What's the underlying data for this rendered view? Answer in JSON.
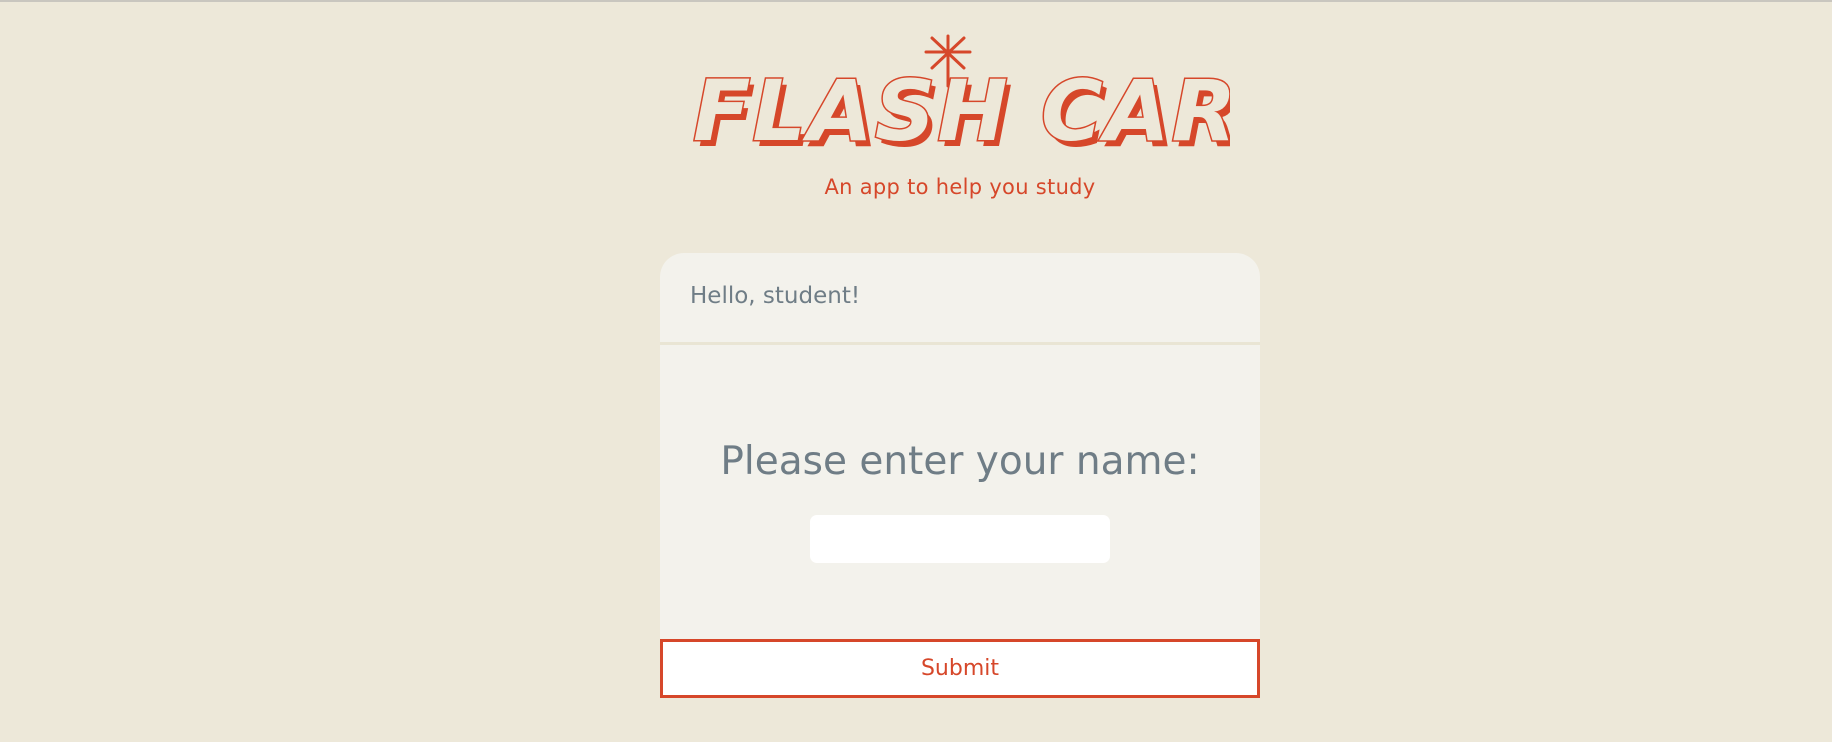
{
  "app": {
    "logo_text": "FLASH CARDS",
    "subtitle": "An app to help you study"
  },
  "card": {
    "greeting": "Hello, student!",
    "prompt": "Please enter your name:",
    "name_input": {
      "value": "",
      "placeholder": ""
    },
    "submit_label": "Submit"
  },
  "colors": {
    "background": "#ede8d9",
    "card": "#f3f2ec",
    "accent": "#d6472a",
    "text": "#6f7d86"
  },
  "icons": {
    "logo_star": "sparkle-star-icon"
  }
}
